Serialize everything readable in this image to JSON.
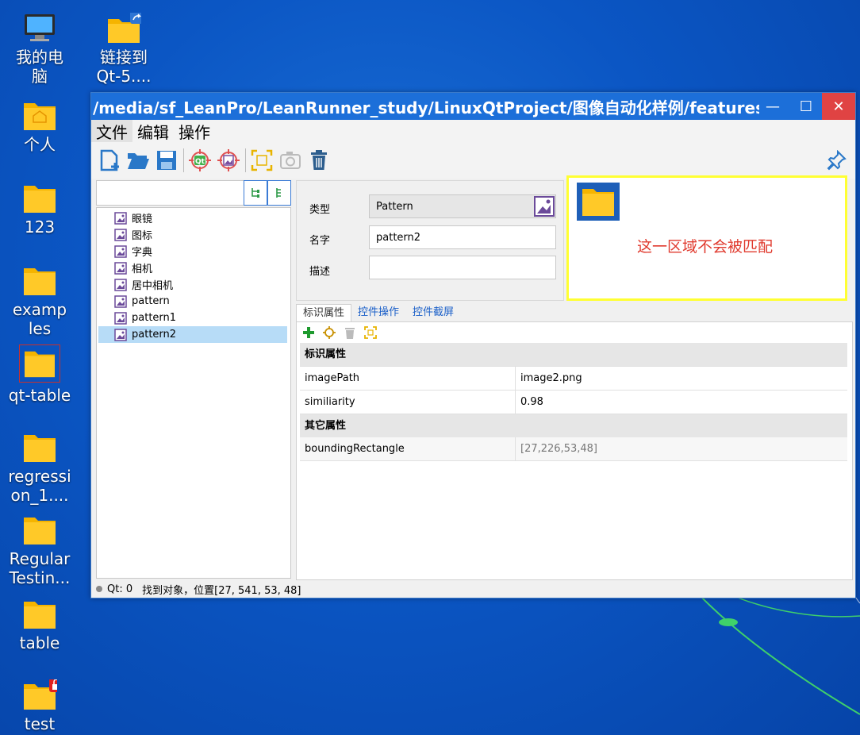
{
  "desktop": {
    "icons": [
      {
        "label": "我的电脑",
        "icon": "computer-icon"
      },
      {
        "label": "链接到Qt-5....",
        "icon": "folder-shortcut-icon"
      },
      {
        "label": "个人",
        "icon": "home-folder-icon"
      },
      {
        "label": "123",
        "icon": "folder-icon"
      },
      {
        "label": "examples",
        "icon": "folder-icon"
      },
      {
        "label": "qt-table",
        "icon": "folder-icon"
      },
      {
        "label": "regression_1....",
        "icon": "folder-icon"
      },
      {
        "label": "RegularTestin...",
        "icon": "folder-icon"
      },
      {
        "label": "table",
        "icon": "folder-icon"
      },
      {
        "label": "test",
        "icon": "locked-folder-icon"
      }
    ]
  },
  "window": {
    "title": "/media/sf_LeanPro/LeanRunner_study/LinuxQtProject/图像自动化样例/features/s...",
    "menu": [
      "文件",
      "编辑",
      "操作"
    ],
    "tree_items": [
      "眼镜",
      "图标",
      "字典",
      "相机",
      "居中相机",
      "pattern",
      "pattern1",
      "pattern2"
    ],
    "selected_index": 7,
    "props": {
      "type_label": "类型",
      "type_value": "Pattern",
      "name_label": "名字",
      "name_value": "pattern2",
      "desc_label": "描述",
      "desc_value": ""
    },
    "preview_note": "这一区域不会被匹配",
    "tabs": [
      "标识属性",
      "控件操作",
      "控件截屏"
    ],
    "grid": {
      "section1": "标识属性",
      "rows1": [
        {
          "key": "imagePath",
          "value": "image2.png"
        },
        {
          "key": "similiarity",
          "value": "0.98"
        }
      ],
      "section2": "其它属性",
      "rows2": [
        {
          "key": "boundingRectangle",
          "value": "[27,226,53,48]"
        }
      ]
    },
    "status": {
      "qt": "Qt: 0",
      "message": "找到对象，位置[27, 541, 53, 48]"
    }
  },
  "colors": {
    "accent": "#1c6fd9",
    "close": "#e04343",
    "highlight_border": "#ffff33",
    "note_text": "#e03a2e",
    "selection": "#b7dcf7"
  }
}
